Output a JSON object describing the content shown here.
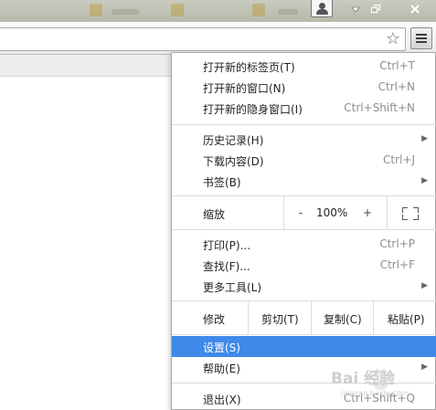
{
  "menu": {
    "new_tab": {
      "label": "打开新的标签页(T)",
      "shortcut": "Ctrl+T"
    },
    "new_window": {
      "label": "打开新的窗口(N)",
      "shortcut": "Ctrl+N"
    },
    "new_incognito": {
      "label": "打开新的隐身窗口(I)",
      "shortcut": "Ctrl+Shift+N"
    },
    "history": {
      "label": "历史记录(H)"
    },
    "downloads": {
      "label": "下载内容(D)",
      "shortcut": "Ctrl+J"
    },
    "bookmarks": {
      "label": "书签(B)"
    },
    "zoom": {
      "label": "缩放",
      "minus": "-",
      "value": "100%",
      "plus": "+"
    },
    "print": {
      "label": "打印(P)...",
      "shortcut": "Ctrl+P"
    },
    "find": {
      "label": "查找(F)...",
      "shortcut": "Ctrl+F"
    },
    "more_tools": {
      "label": "更多工具(L)"
    },
    "edit": {
      "label": "修改",
      "cut": "剪切(T)",
      "copy": "复制(C)",
      "paste": "粘贴(P)"
    },
    "settings": {
      "label": "设置(S)"
    },
    "help": {
      "label": "帮助(E)"
    },
    "exit": {
      "label": "退出(X)",
      "shortcut": "Ctrl+Shift+Q"
    }
  },
  "colors": {
    "highlight": "#3f8ae8"
  },
  "icons": {
    "profile": "profile-icon",
    "minimize": "minimize-icon",
    "restore": "restore-icon",
    "close": "close-icon",
    "star": "star-icon",
    "menu": "hamburger-menu-icon",
    "submenu": "chevron-right-icon",
    "fullscreen": "fullscreen-icon"
  },
  "watermark": {
    "text": "Bai 经验",
    "sub": "jingyan.baidu.com"
  }
}
